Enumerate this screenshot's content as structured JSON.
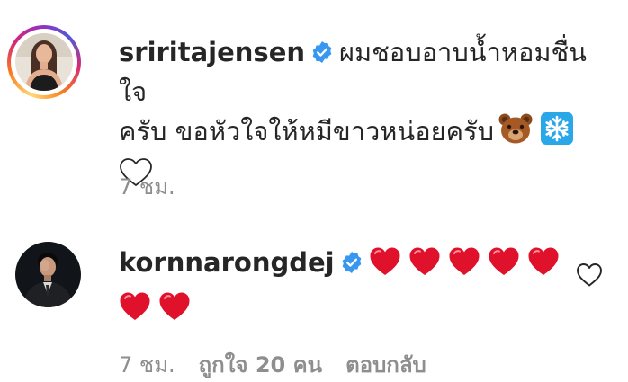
{
  "comments": [
    {
      "username": "sriritajensen",
      "verified": true,
      "text_line1": "ผมชอบอาบน้ำหอมชื่นใจ",
      "text_line2": "ครับ ขอหัวใจให้หมีขาวหน่อยครับ",
      "emojis": [
        "bear-face",
        "snowflake",
        "white-heart"
      ],
      "time": "7 ชม.",
      "avatar_has_story_ring": true
    },
    {
      "username": "kornnarongdej",
      "verified": true,
      "red_hearts": 7,
      "time": "7 ชม.",
      "likes_label": "ถูกใจ 20 คน",
      "reply_label": "ตอบกลับ",
      "like_icon": "heart-outline-icon"
    }
  ],
  "colors": {
    "text": "#262626",
    "meta": "#8e8e8e",
    "verified": "#3897f0",
    "heart_red": "#e0112b"
  }
}
